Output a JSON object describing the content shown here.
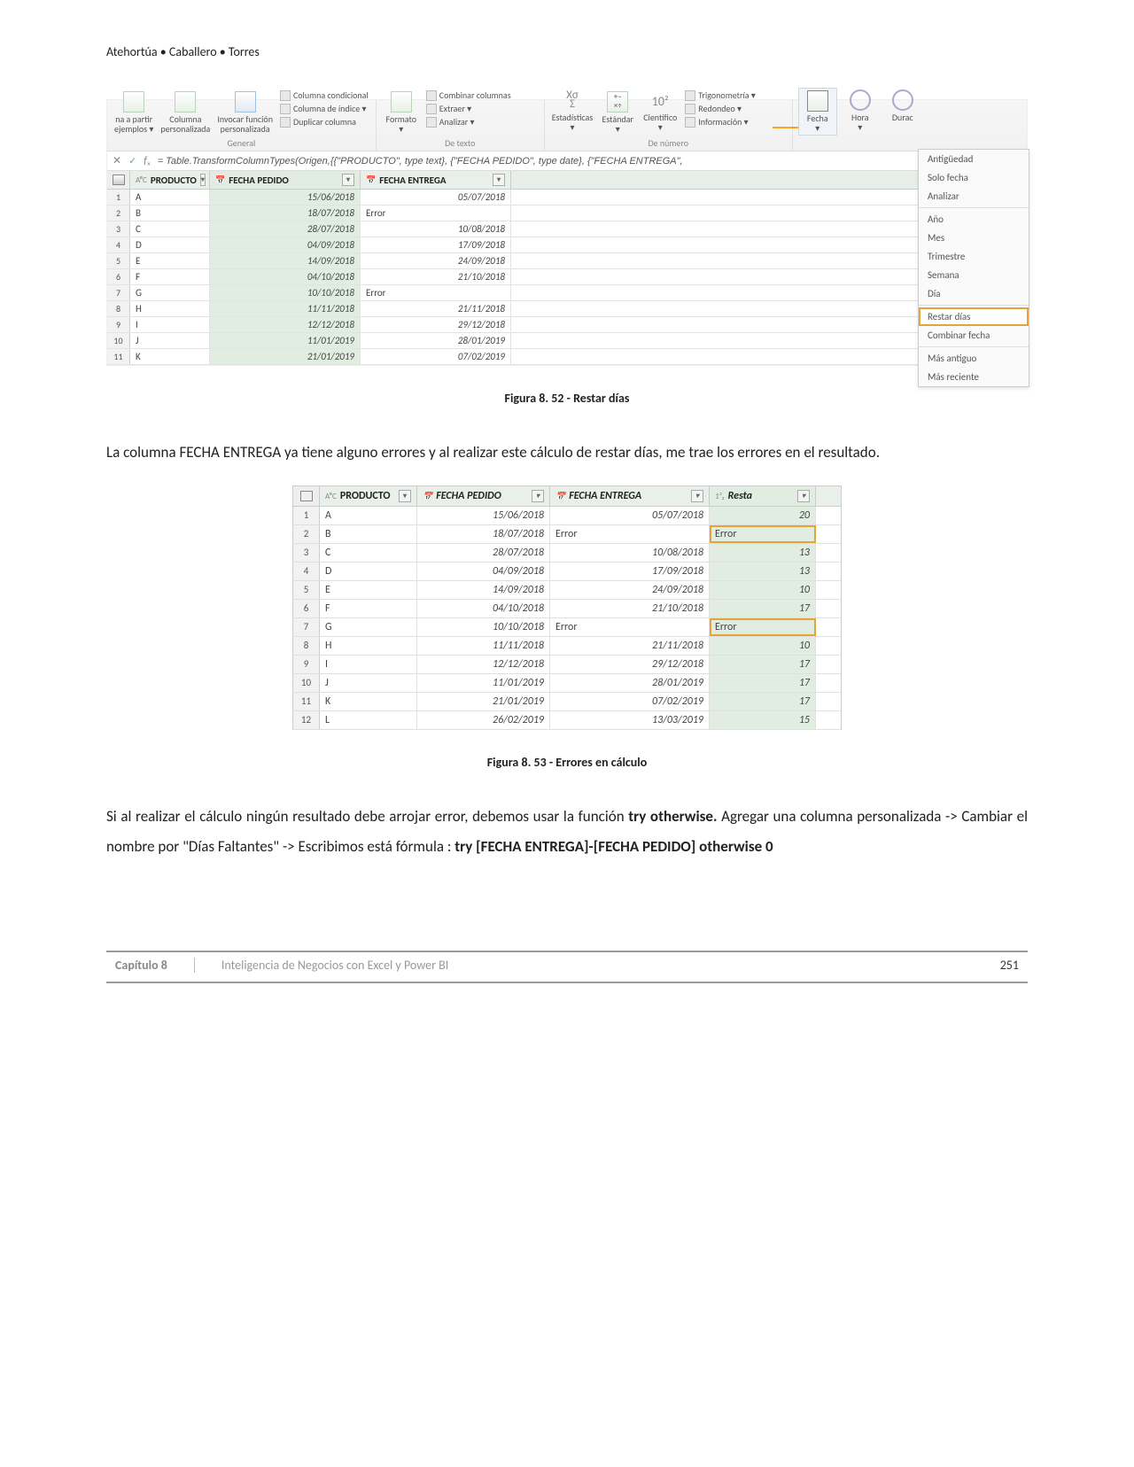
{
  "header_authors": "Atehortúa • Caballero • Torres",
  "ribbon": {
    "big_items": {
      "na_partir": "na a partir\nejemplos ▾",
      "columna": "Columna\npersonalizada",
      "invocar": "Invocar función\npersonalizada",
      "formato": "Formato\n▾",
      "estadisticas": "Estadísticas\n▾",
      "estandar": "Estándar\n▾",
      "cientifico": "Científico\n▾",
      "fecha": "Fecha\n▾",
      "hora": "Hora\n▾",
      "durac": "Durac"
    },
    "small": {
      "col_cond": "Columna condicional",
      "col_idx": "Columna de índice ▾",
      "dup_col": "Duplicar columna",
      "combinar": "Combinar columnas",
      "extraer": "Extraer ▾",
      "analizar": "Analizar ▾",
      "trig": "Trigonometría ▾",
      "redondeo": "Redondeo ▾",
      "info": "Información ▾"
    },
    "sigma": "Χσ\nΣ",
    "tenpow": "10²",
    "groups": {
      "general": "General",
      "detexto": "De texto",
      "denumero": "De número"
    }
  },
  "date_menu": {
    "antiguedad": "Antigüedad",
    "solofecha": "Solo fecha",
    "analizar": "Analizar",
    "ano": "Año",
    "mes": "Mes",
    "trimestre": "Trimestre",
    "semana": "Semana",
    "dia": "Día",
    "restar": "Restar días",
    "combinar": "Combinar fecha",
    "masantiguo": "Más antiguo",
    "masreciente": "Más reciente"
  },
  "formula": "= Table.TransformColumnTypes(Origen,{{\"PRODUCTO\", type text}, {\"FECHA PEDIDO\", type date}, {\"FECHA ENTREGA\",",
  "table1": {
    "headers": {
      "producto": "PRODUCTO",
      "fp": "FECHA PEDIDO",
      "fe": "FECHA ENTREGA",
      "typ_abc": "AᴮC",
      "typ_date": "📅"
    },
    "rows": [
      {
        "n": "1",
        "p": "A",
        "fp": "15/06/2018",
        "fe": "05/07/2018"
      },
      {
        "n": "2",
        "p": "B",
        "fp": "18/07/2018",
        "fe": "Error",
        "err": true
      },
      {
        "n": "3",
        "p": "C",
        "fp": "28/07/2018",
        "fe": "10/08/2018"
      },
      {
        "n": "4",
        "p": "D",
        "fp": "04/09/2018",
        "fe": "17/09/2018"
      },
      {
        "n": "5",
        "p": "E",
        "fp": "14/09/2018",
        "fe": "24/09/2018"
      },
      {
        "n": "6",
        "p": "F",
        "fp": "04/10/2018",
        "fe": "21/10/2018"
      },
      {
        "n": "7",
        "p": "G",
        "fp": "10/10/2018",
        "fe": "Error",
        "err": true
      },
      {
        "n": "8",
        "p": "H",
        "fp": "11/11/2018",
        "fe": "21/11/2018"
      },
      {
        "n": "9",
        "p": "I",
        "fp": "12/12/2018",
        "fe": "29/12/2018"
      },
      {
        "n": "10",
        "p": "J",
        "fp": "11/01/2019",
        "fe": "28/01/2019"
      },
      {
        "n": "11",
        "p": "K",
        "fp": "21/01/2019",
        "fe": "07/02/2019"
      }
    ]
  },
  "caption1": "Figura 8. 52 - Restar días",
  "para1": "La columna FECHA ENTREGA ya tiene alguno errores y al realizar este cálculo de restar días, me trae los errores en el resultado.",
  "table2": {
    "headers": {
      "producto": "PRODUCTO",
      "fp": "FECHA PEDIDO",
      "fe": "FECHA ENTREGA",
      "resta": "Resta",
      "typ_abc": "AᴮC",
      "typ_date": "📅",
      "typ_num": "1²₃"
    },
    "rows": [
      {
        "n": "1",
        "p": "A",
        "fp": "15/06/2018",
        "fe": "05/07/2018",
        "r": "20"
      },
      {
        "n": "2",
        "p": "B",
        "fp": "18/07/2018",
        "fe": "Error",
        "feerr": true,
        "r": "Error",
        "rerr": true
      },
      {
        "n": "3",
        "p": "C",
        "fp": "28/07/2018",
        "fe": "10/08/2018",
        "r": "13"
      },
      {
        "n": "4",
        "p": "D",
        "fp": "04/09/2018",
        "fe": "17/09/2018",
        "r": "13"
      },
      {
        "n": "5",
        "p": "E",
        "fp": "14/09/2018",
        "fe": "24/09/2018",
        "r": "10"
      },
      {
        "n": "6",
        "p": "F",
        "fp": "04/10/2018",
        "fe": "21/10/2018",
        "r": "17"
      },
      {
        "n": "7",
        "p": "G",
        "fp": "10/10/2018",
        "fe": "Error",
        "feerr": true,
        "r": "Error",
        "rerr": true
      },
      {
        "n": "8",
        "p": "H",
        "fp": "11/11/2018",
        "fe": "21/11/2018",
        "r": "10"
      },
      {
        "n": "9",
        "p": "I",
        "fp": "12/12/2018",
        "fe": "29/12/2018",
        "r": "17"
      },
      {
        "n": "10",
        "p": "J",
        "fp": "11/01/2019",
        "fe": "28/01/2019",
        "r": "17"
      },
      {
        "n": "11",
        "p": "K",
        "fp": "21/01/2019",
        "fe": "07/02/2019",
        "r": "17"
      },
      {
        "n": "12",
        "p": "L",
        "fp": "26/02/2019",
        "fe": "13/03/2019",
        "r": "15"
      }
    ]
  },
  "caption2": "Figura 8. 53 - Errores en cálculo",
  "para2_a": "Si al realizar el cálculo ningún resultado debe arrojar error, debemos usar la función ",
  "para2_b": "try otherwise.",
  "para2_c": " Agregar una columna personalizada -> Cambiar el nombre por \"Días Faltantes\" -> Escribimos está fórmula : ",
  "para2_d": "try [FECHA ENTREGA]-[FECHA PEDIDO] otherwise 0",
  "footer": {
    "chapter": "Capítulo 8",
    "title": "Inteligencia de Negocios con Excel y Power BI",
    "page": "251"
  }
}
